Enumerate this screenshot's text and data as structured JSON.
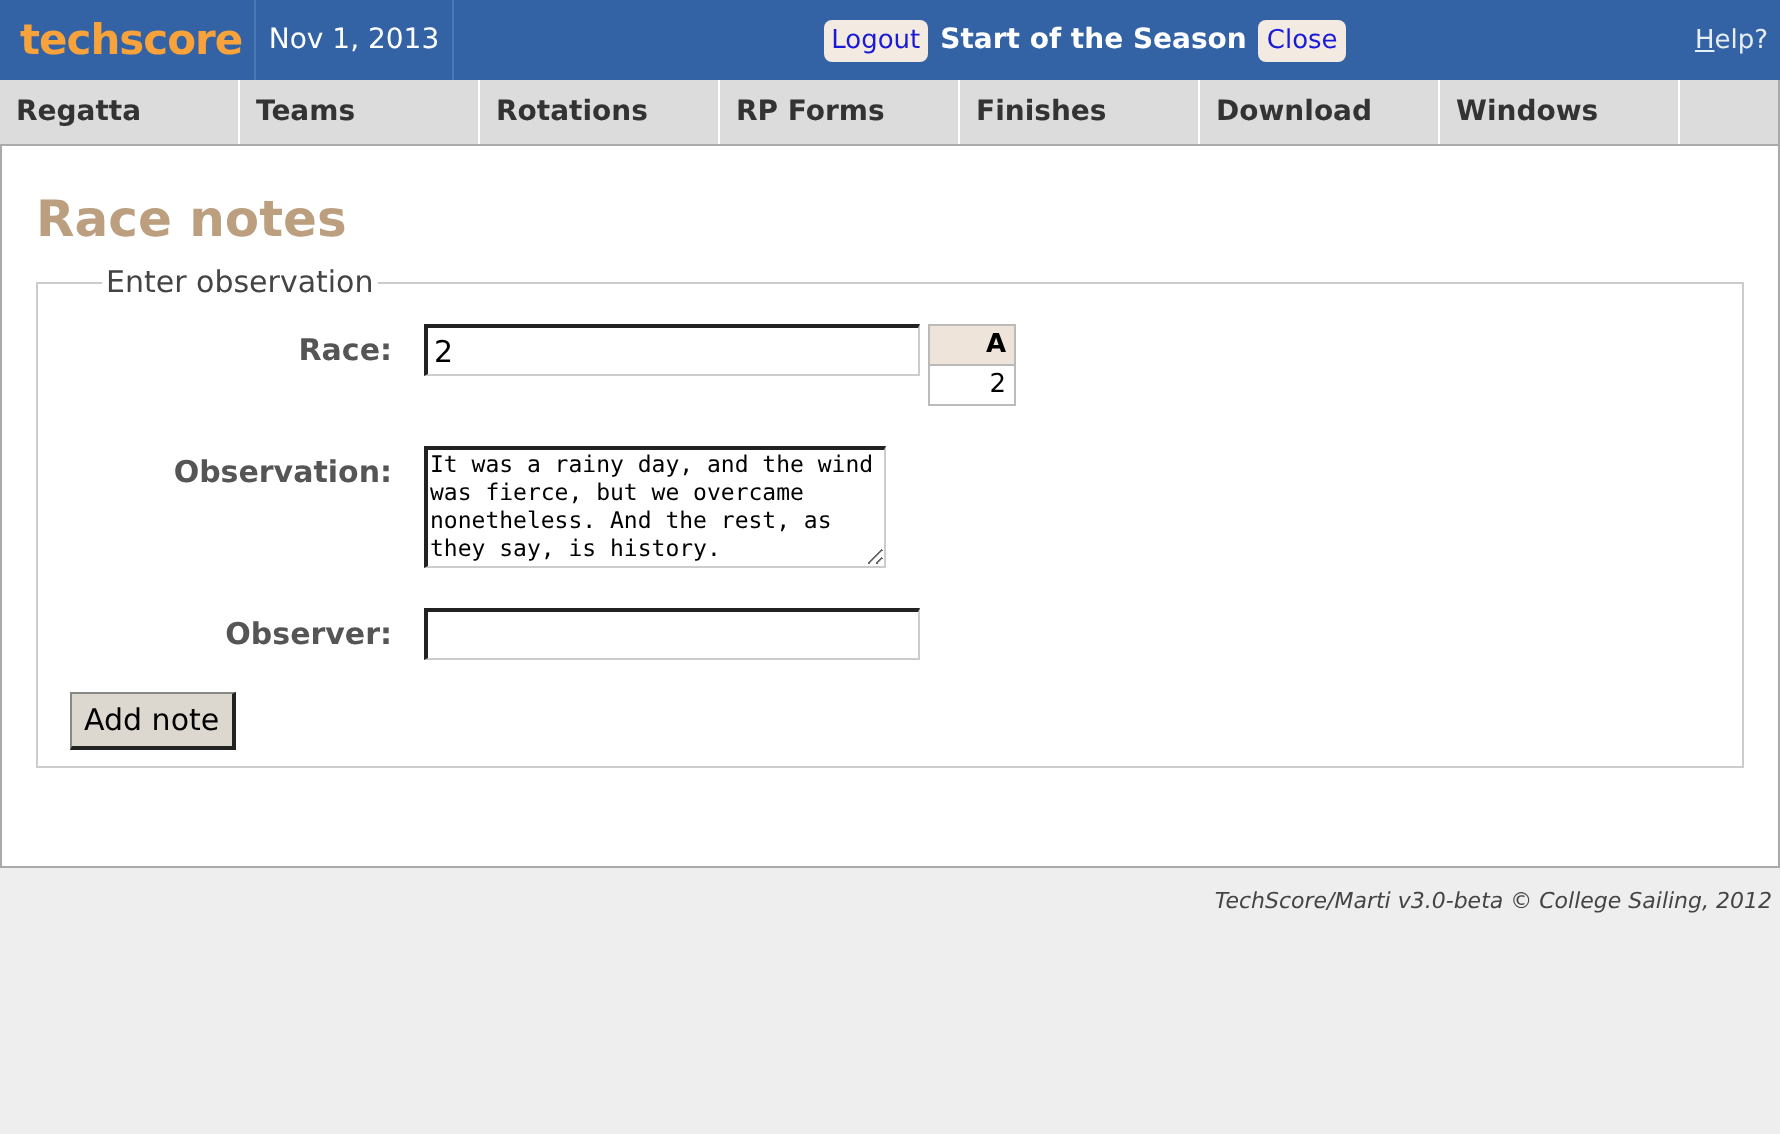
{
  "header": {
    "logo": "techscore",
    "date": "Nov 1, 2013",
    "logout": "Logout",
    "regatta_title": "Start of the Season",
    "close": "Close",
    "help": "Help?"
  },
  "nav": [
    {
      "label": "Regatta"
    },
    {
      "label": "Teams"
    },
    {
      "label": "Rotations"
    },
    {
      "label": "RP Forms"
    },
    {
      "label": "Finishes"
    },
    {
      "label": "Download"
    },
    {
      "label": "Windows"
    }
  ],
  "page_title": "Race notes",
  "form": {
    "legend": "Enter observation",
    "race": {
      "label": "Race:",
      "value": "2"
    },
    "race_table": {
      "column": "A",
      "value": "2"
    },
    "observation": {
      "label": "Observation:",
      "value": "It was a rainy day, and the wind was fierce, but we overcame nonetheless. And the rest, as they say, is history."
    },
    "observer": {
      "label": "Observer:"
    },
    "submit": "Add note"
  },
  "footer": "TechScore/Marti v3.0-beta © College Sailing, 2012"
}
